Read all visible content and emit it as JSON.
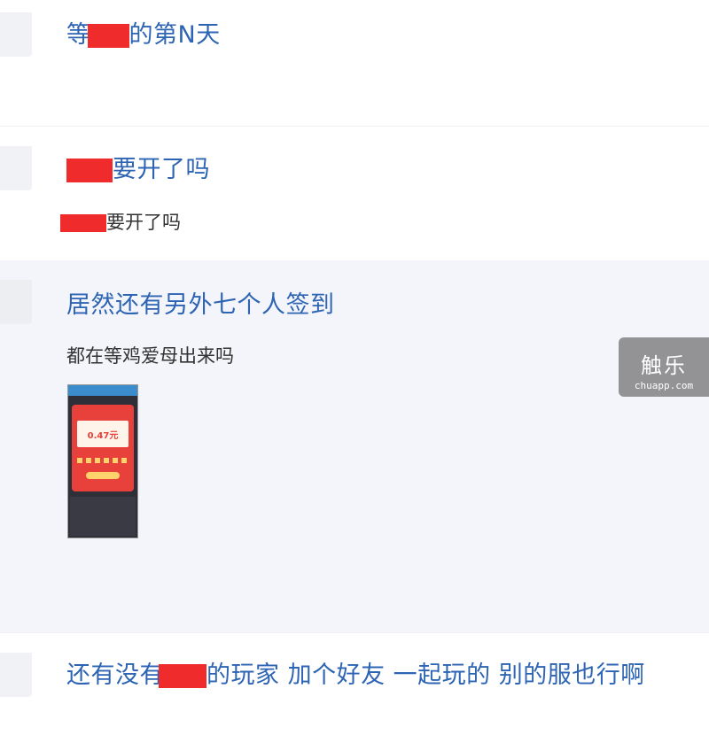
{
  "posts": [
    {
      "title_pre": "等",
      "title_post": "的第N天",
      "excerpt": ""
    },
    {
      "title_pre": "",
      "title_post": "要开了吗",
      "excerpt_post": "要开了吗"
    },
    {
      "title": "居然还有另外七个人签到",
      "excerpt": "都在等鸡爱母出来吗",
      "thumb_money": "0.47元"
    },
    {
      "title_pre": "还有没有",
      "title_post": "的玩家 加个好友 一起玩的 别的服也行啊"
    }
  ],
  "watermark": {
    "logo": "触乐",
    "url": "chuapp.com"
  }
}
